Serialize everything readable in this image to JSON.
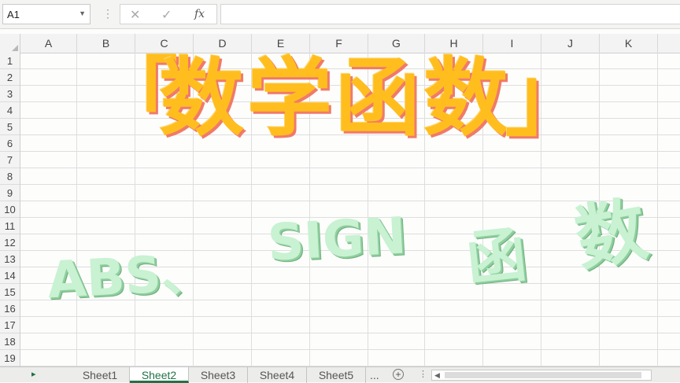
{
  "formula_bar": {
    "name_box": "A1",
    "fx_label": "fx",
    "formula_value": ""
  },
  "columns": [
    "A",
    "B",
    "C",
    "D",
    "E",
    "F",
    "G",
    "H",
    "I",
    "J",
    "K"
  ],
  "rows": [
    "1",
    "2",
    "3",
    "4",
    "5",
    "6",
    "7",
    "8",
    "9",
    "10",
    "11",
    "12",
    "13",
    "14",
    "15",
    "16",
    "17",
    "18",
    "19"
  ],
  "overlay": {
    "title_open": "「",
    "title": "数学函数",
    "title_close": "」",
    "sub_abs": "ABS、",
    "sub_sign": "SIGN",
    "sub_han": "函",
    "sub_shu": "数"
  },
  "sheet_tabs": [
    "Sheet1",
    "Sheet2",
    "Sheet3",
    "Sheet4",
    "Sheet5"
  ],
  "active_sheet": "Sheet2",
  "tab_more": "...",
  "colors": {
    "title_fill": "#ffbe1e",
    "title_shadow": "#f07a6a",
    "subtitle_fill": "#c8f2d2",
    "excel_green": "#217346"
  }
}
